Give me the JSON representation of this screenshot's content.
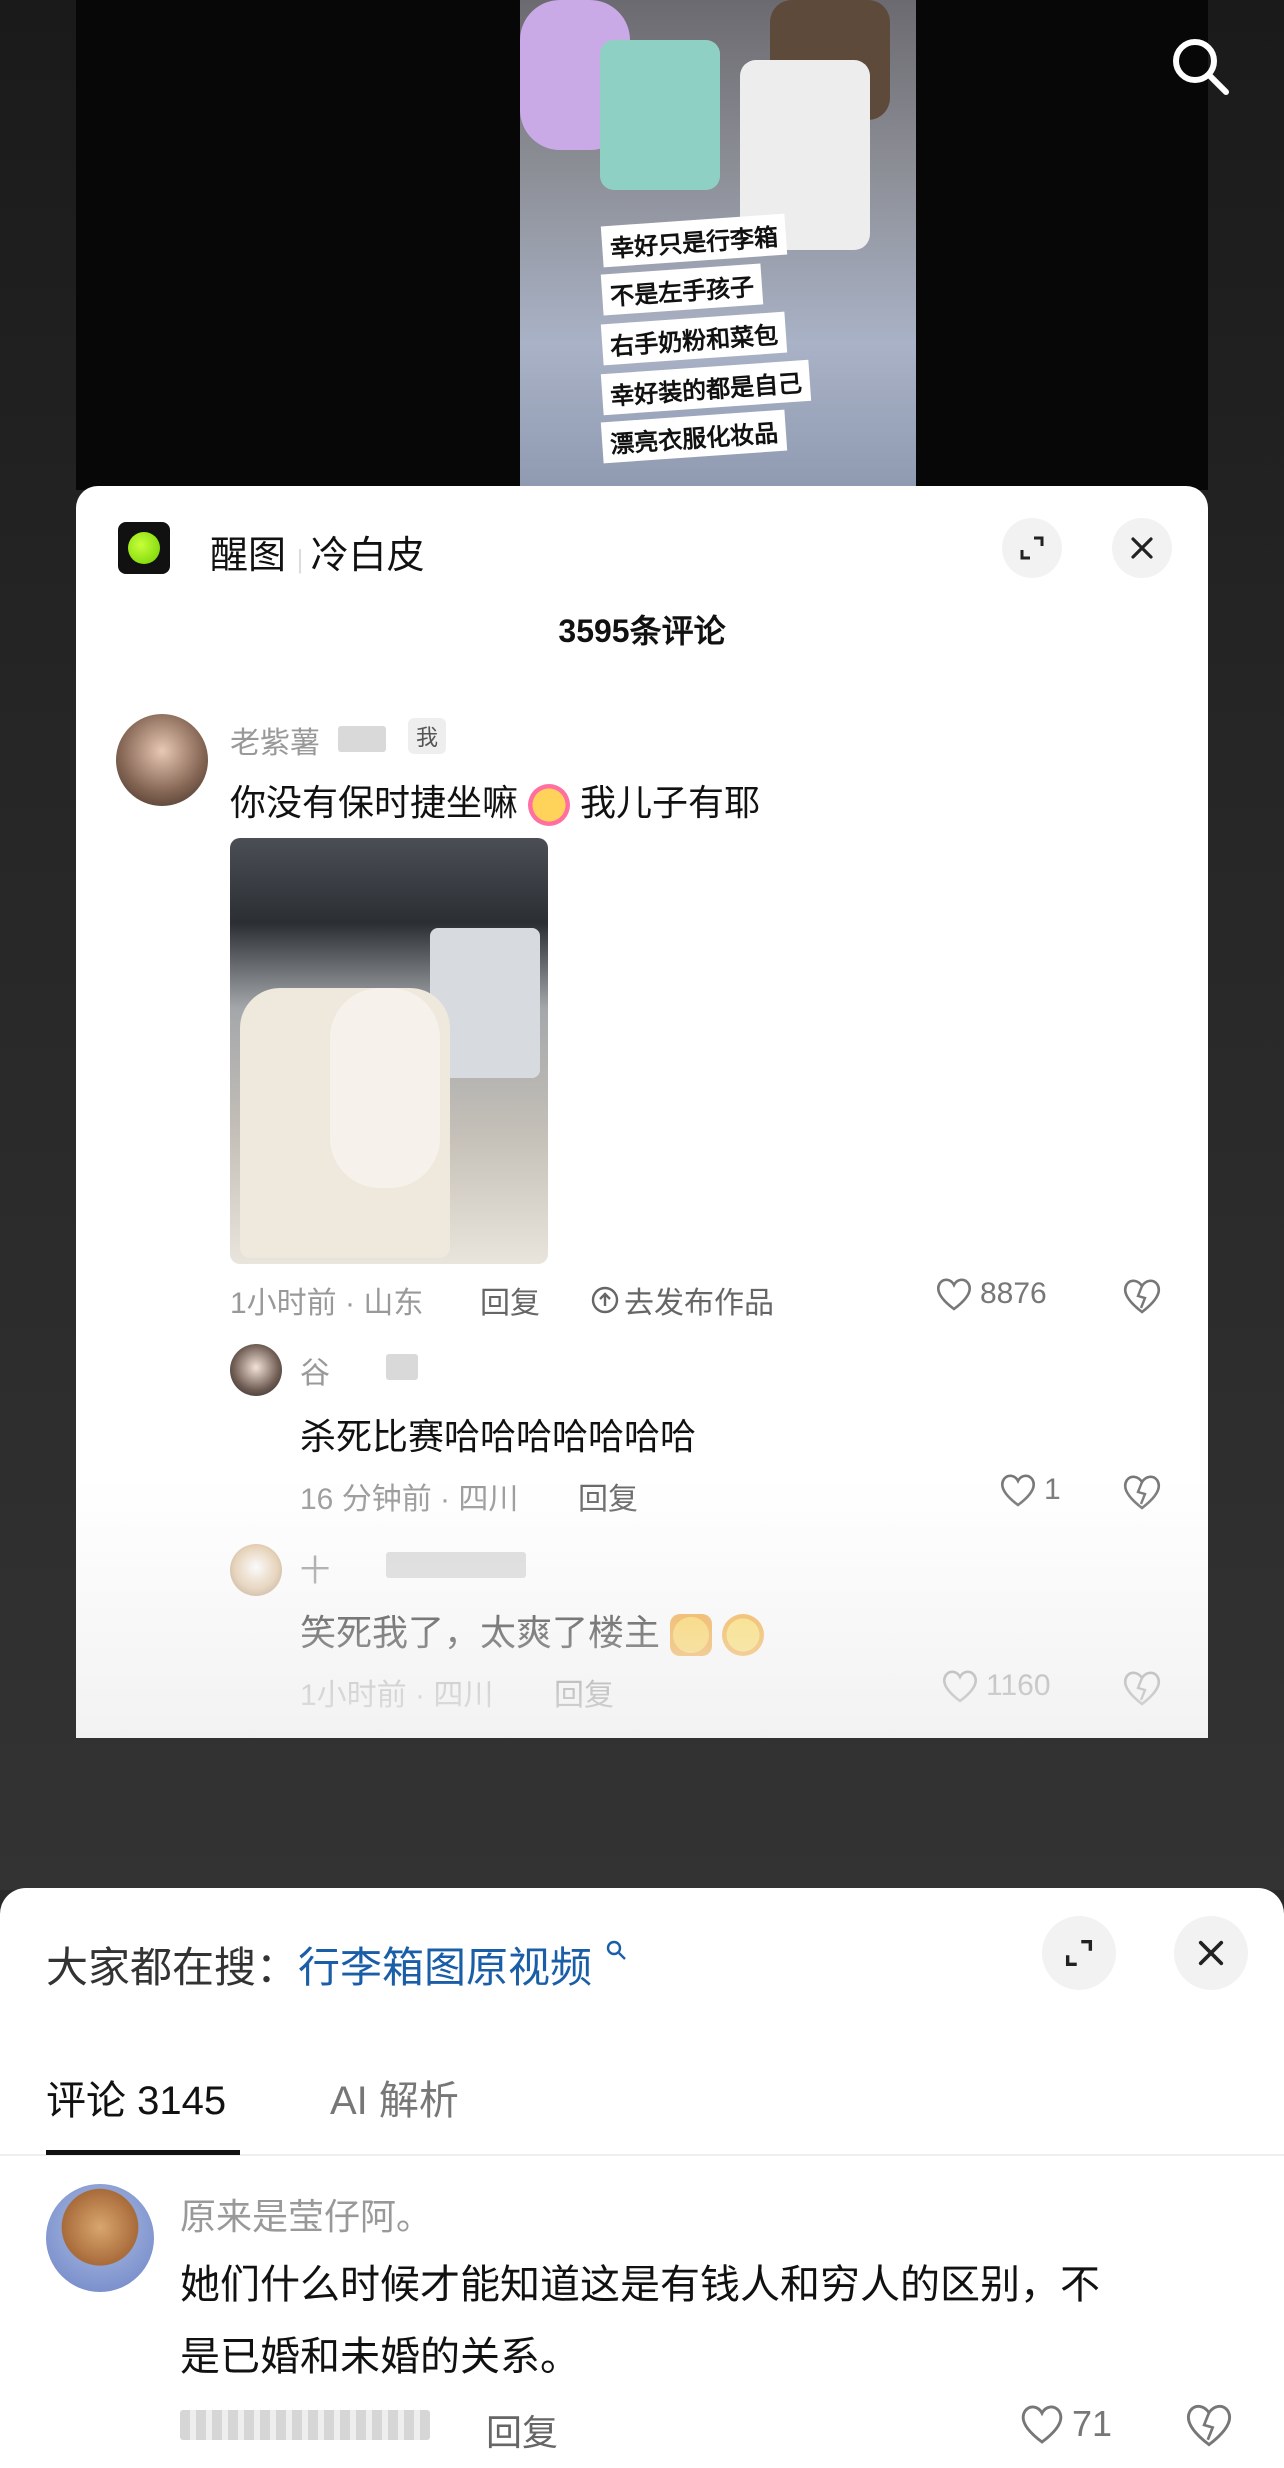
{
  "video": {
    "caption_lines": [
      "幸好只是行李箱",
      "不是左手孩子",
      "右手奶粉和菜包",
      "幸好装的都是自己",
      "漂亮衣服化妆品"
    ]
  },
  "inner_card": {
    "brand_name": "醒图",
    "brand_subtitle": "冷白皮",
    "comment_count": "3595条评论",
    "comments": [
      {
        "username": "老紫薯",
        "badge": "我",
        "text_before_emoji": "你没有保时捷坐嘛",
        "text_after_emoji": "我儿子有耶",
        "meta": "1小时前 · 山东",
        "reply_label": "回复",
        "publish_label": "去发布作品",
        "likes": "8876"
      }
    ],
    "replies": [
      {
        "username": "谷",
        "text": "杀死比赛哈哈哈哈哈哈哈",
        "meta": "16 分钟前 · 四川",
        "reply_label": "回复",
        "likes": "1"
      },
      {
        "username": "十",
        "text": "笑死我了，太爽了楼主",
        "meta": "1小时前 · 四川",
        "reply_label": "回复",
        "likes": "1160"
      }
    ]
  },
  "bottom_sheet": {
    "search_prefix": "大家都在搜：",
    "search_link": "行李箱图原视频",
    "tabs": [
      {
        "label": "评论 3145",
        "active": true
      },
      {
        "label": "AI 解析",
        "active": false
      }
    ],
    "comment": {
      "username": "原来是莹仔阿。",
      "text_line1": "她们什么时候才能知道这是有钱人和穷人的区别，不",
      "text_line2": "是已婚和未婚的关系。",
      "reply_label": "回复",
      "likes": "71"
    }
  },
  "colors": {
    "link_blue": "#1a5ea8",
    "brand_green": "#8ee61a"
  }
}
